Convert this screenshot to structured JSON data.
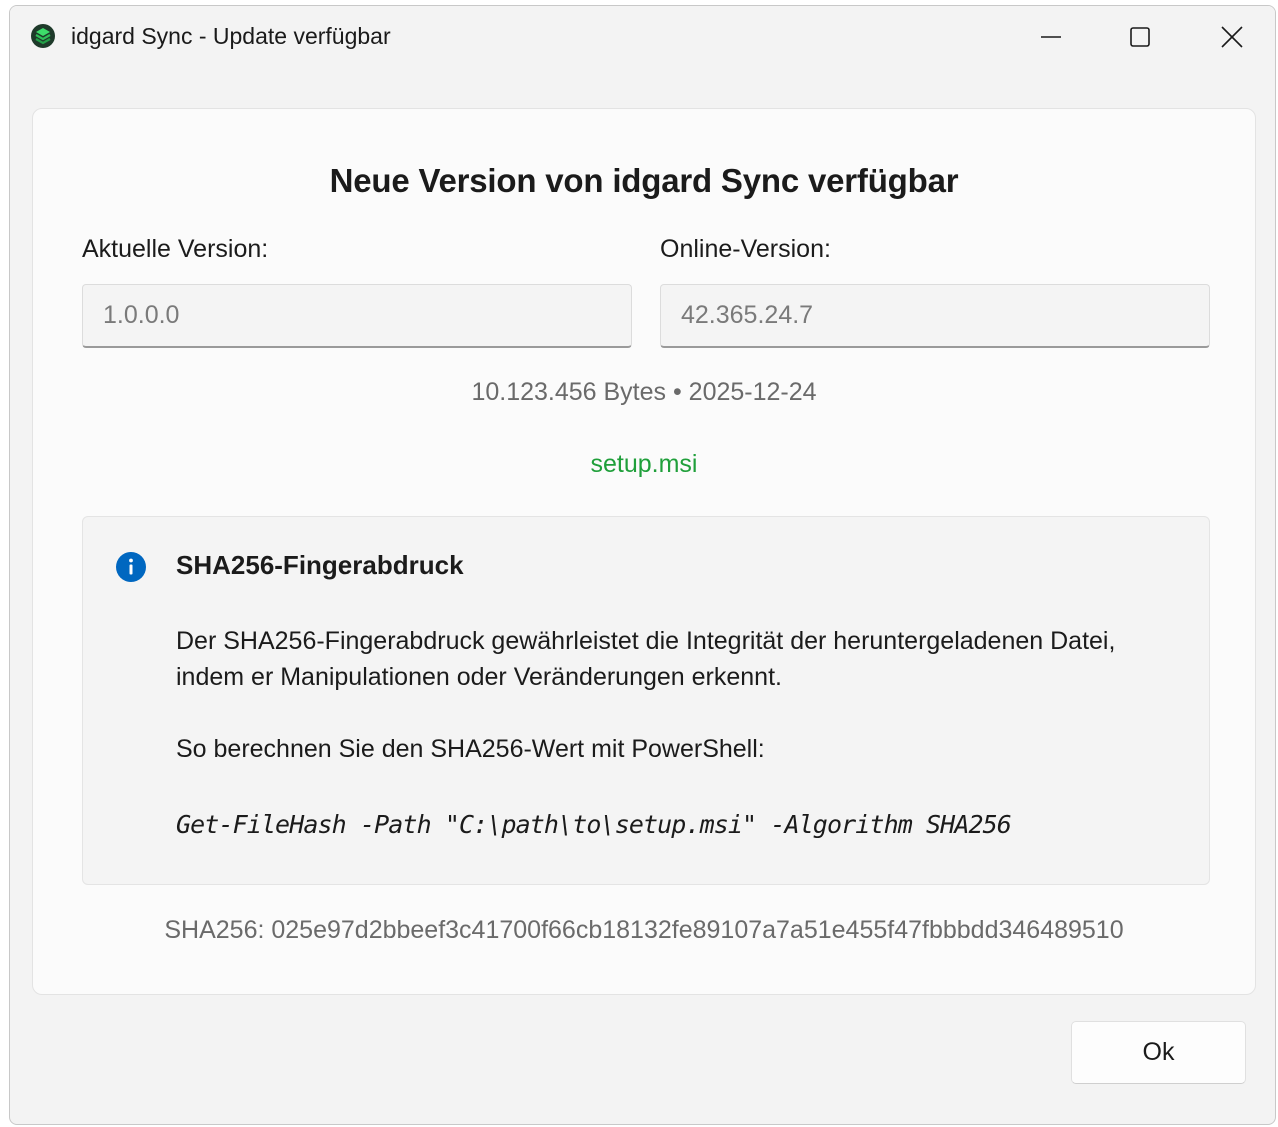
{
  "window": {
    "title": "idgard Sync - Update verfügbar",
    "app_icon": "idgard-app-icon",
    "controls": {
      "minimize_icon": "minimize-icon",
      "maximize_icon": "maximize-icon",
      "close_icon": "close-icon"
    }
  },
  "main": {
    "heading": "Neue Version von idgard Sync verfügbar",
    "current_version": {
      "label": "Aktuelle Version:",
      "value": "1.0.0.0"
    },
    "online_version": {
      "label": "Online-Version:",
      "value": "42.365.24.7"
    },
    "meta": "10.123.456 Bytes • 2025-12-24",
    "file_link": "setup.msi",
    "info": {
      "icon": "info-icon",
      "title": "SHA256-Fingerabdruck",
      "description": "Der SHA256-Fingerabdruck gewährleistet die Integrität der heruntergeladenen Datei, indem er Manipulationen oder Veränderungen erkennt.",
      "powershell_hint": "So berechnen Sie den SHA256-Wert mit PowerShell:",
      "command": "Get-FileHash -Path \"C:\\path\\to\\setup.msi\" -Algorithm SHA256"
    },
    "sha256": "SHA256: 025e97d2bbeef3c41700f66cb18132fe89107a7a51e455f47fbbbdd346489510"
  },
  "footer": {
    "ok_label": "Ok"
  },
  "colors": {
    "link_green": "#1f9f3a",
    "info_blue": "#0067c0"
  }
}
